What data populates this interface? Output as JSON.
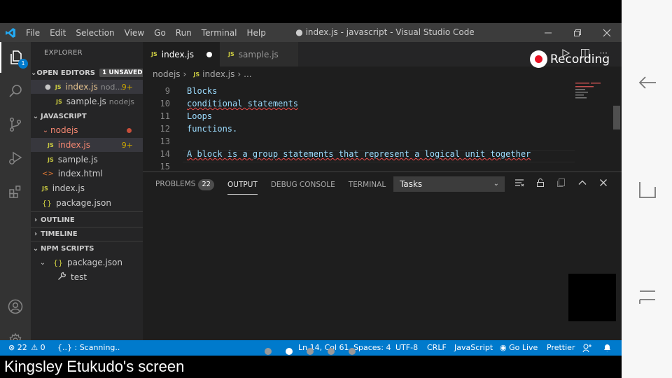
{
  "title_bar": {
    "menu": [
      "File",
      "Edit",
      "Selection",
      "View",
      "Go",
      "Run",
      "Terminal",
      "Help"
    ],
    "window_title": "● index.js - javascript - Visual Studio Code"
  },
  "activity_bar": {
    "explorer_badge": "1"
  },
  "sidebar": {
    "title": "EXPLORER",
    "open_editors": {
      "header": "OPEN EDITORS",
      "unsaved_badge": "1 UNSAVED",
      "items": [
        {
          "name": "index.js",
          "desc": "nod...",
          "warn": "9+"
        },
        {
          "name": "sample.js",
          "desc": "nodejs"
        }
      ]
    },
    "workspace": {
      "header": "JAVASCRIPT",
      "folder": "nodejs",
      "items": [
        {
          "name": "index.js",
          "warn": "9+"
        },
        {
          "name": "sample.js"
        },
        {
          "name": "index.html"
        },
        {
          "name": "index.js"
        },
        {
          "name": "package.json"
        }
      ]
    },
    "outline": "OUTLINE",
    "timeline": "TIMELINE",
    "npm": {
      "header": "NPM SCRIPTS",
      "package": "package.json",
      "script": "test"
    }
  },
  "editor": {
    "tabs": [
      {
        "label": "index.js",
        "active": true,
        "dirty": true
      },
      {
        "label": "sample.js",
        "active": false
      }
    ],
    "breadcrumb": {
      "folder": "nodejs",
      "file": "index.js",
      "more": "..."
    },
    "lines": [
      {
        "n": "9",
        "text": "Blocks"
      },
      {
        "n": "10",
        "text": "conditional statements"
      },
      {
        "n": "11",
        "text": "Loops"
      },
      {
        "n": "12",
        "text": "functions."
      },
      {
        "n": "13",
        "text": ""
      },
      {
        "n": "14",
        "text": "A block is a group statements that represent a logical unit together"
      },
      {
        "n": "15",
        "text": ""
      }
    ]
  },
  "panel": {
    "tabs": [
      "PROBLEMS",
      "OUTPUT",
      "DEBUG CONSOLE",
      "TERMINAL"
    ],
    "problems_count": "22",
    "task_select": "Tasks"
  },
  "status_bar": {
    "errors": "22",
    "warnings": "0",
    "scanning": "{..} : Scanning..",
    "position": "Ln 14, Col 61",
    "spaces": "Spaces: 4",
    "encoding": "UTF-8",
    "eol": "CRLF",
    "language": "JavaScript",
    "golive": "Go Live",
    "prettier": "Prettier"
  },
  "overlay": {
    "recording": "Recording",
    "caption": "Kingsley Etukudo's screen"
  }
}
